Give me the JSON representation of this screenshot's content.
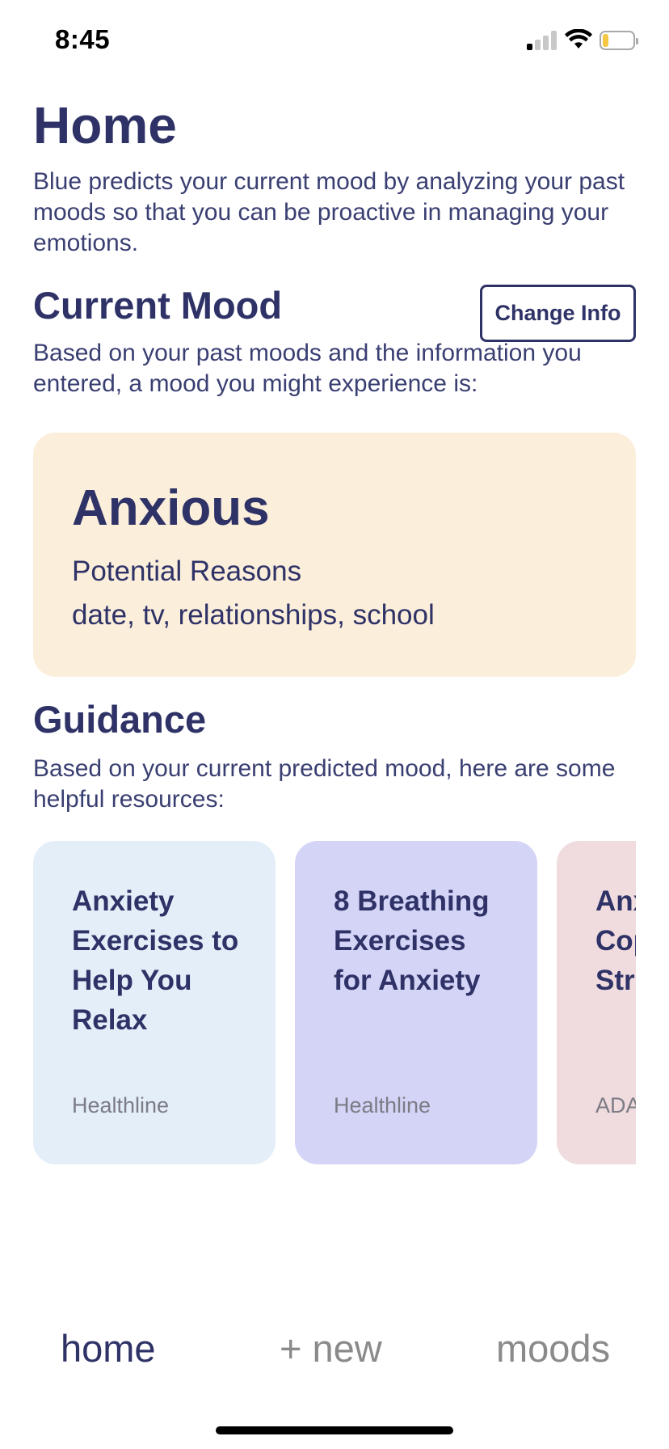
{
  "status_bar": {
    "time": "8:45"
  },
  "page": {
    "title": "Home",
    "intro": "Blue predicts your current mood by analyzing your past moods so that you can be proactive in managing your emotions."
  },
  "current_mood": {
    "title": "Current Mood",
    "change_button": "Change Info",
    "description": "Based on your past moods and the information you entered, a mood you might experience is:",
    "mood": "Anxious",
    "reasons_title": "Potential Reasons",
    "reasons": "date, tv, relationships, school",
    "card_color": "#fbeedb"
  },
  "guidance": {
    "title": "Guidance",
    "description": "Based on your current predicted mood, here are some helpful resources:",
    "resources": [
      {
        "title_lines": [
          "Anxiety",
          "Exercises to",
          "Help You",
          "Relax"
        ],
        "source": "Healthline",
        "color": "#e3eef9"
      },
      {
        "title_lines": [
          "8 Breathing",
          "Exercises",
          "for Anxiety"
        ],
        "source": "Healthline",
        "color": "#d4d4f7"
      },
      {
        "title_lines": [
          "Anx",
          "Cop",
          "Str"
        ],
        "source": "ADA",
        "color": "#f0dcdf"
      }
    ]
  },
  "tabbar": {
    "home": "home",
    "new": "+ new",
    "moods": "moods",
    "active_color": "#2e3266",
    "inactive_color": "#8a8a8a"
  }
}
